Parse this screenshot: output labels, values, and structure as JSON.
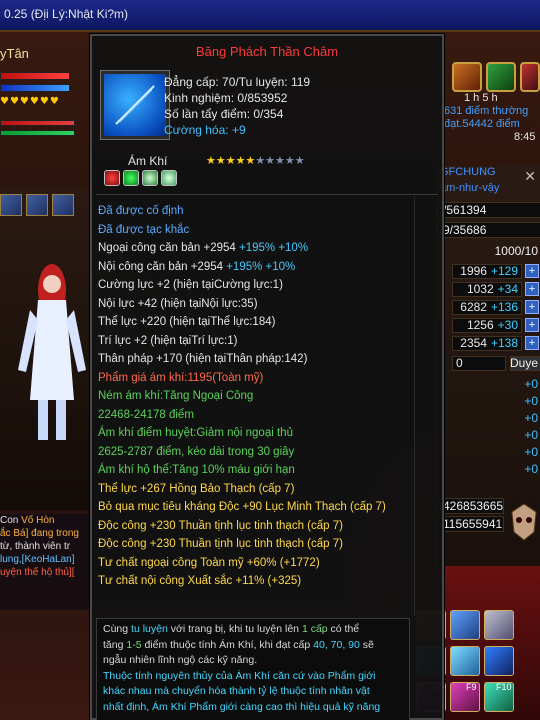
{
  "window": {
    "title": "0.25 (Địi Lý:Nhật Ki?m)"
  },
  "character": {
    "name": "yTân"
  },
  "tooltip": {
    "title": "Băng Phách Thần Châm",
    "level_line": "Đẳng cấp: 70/Tu luyện: 119",
    "exp_line": "Kinh nghiệm: 0/853952",
    "wash_line": "Số lần tẩy điểm: 0/354",
    "enhance_line": "Cường hóa: +9",
    "item_type": "Ám Khí",
    "stars_on": "★★★★★",
    "stars_off": "★★★★★",
    "lines": {
      "fixed": "Đã được cố định",
      "engraved": "Đã được tạc khắc",
      "ext_base": "Ngoại công căn bản +2954",
      "ext_base_bonus": "+195% +10%",
      "int_base": "Nội công căn bản +2954",
      "int_base_bonus": "+195% +10%",
      "str": "Cường lực +2 (hiện tạiCường lực:1)",
      "inner": "Nội lực +42 (hiện tạiNội lực:35)",
      "phys": "Thể lực +220 (hiện tạiThể lực:184)",
      "wis": "Trí lực +2 (hiện tạiTrí lực:1)",
      "agi": "Thân pháp +170 (hiện tạiThân pháp:142)",
      "grade": "Phẩm giá ám khí:1195(Toàn mỹ)",
      "throw1": "Ném ám khí:Tăng Ngoại Công",
      "throw2": "22468-24178 điểm",
      "acu1": "Ám khí điểm huyệt:Giảm nội ngoại thủ",
      "acu2": "2625-2787 điểm, kéo dài trong 30 giây",
      "guard": "Ám khí hộ thể:Tăng 10% máu giới hạn",
      "gem1": "Thể lực +267 Hồng Bảo Thạch (cấp 7)",
      "gem2": "Bỏ qua mục tiêu kháng Độc +90 Lục Minh Thạch (cấp 7)",
      "gem3": "Độc công +230 Thuần tịnh lục tinh thạch (cấp 7)",
      "gem4": "Độc công +230 Thuần tịnh lục tinh thạch (cấp 7)",
      "apt1": "Tư chất ngoại công  Toàn mỹ +60% (+1772)",
      "apt2": "Tư chất nội công  Xuất sắc +11% (+325)"
    },
    "footer": {
      "p1_a": "Cùng ",
      "p1_b": "tu luyện",
      "p1_c": " với trang bị, khi tu luyện lên ",
      "p1_d": "1 cấp",
      "p1_e": " có thể",
      "p2_a": "tăng ",
      "p2_b": "1-5",
      "p2_c": " điểm thuộc tính Ám Khí, khi đạt cấp ",
      "p2_d": "40, 70, 90",
      "p2_e": " sẽ",
      "p3": "ngẫu nhiên lĩnh ngộ các kỹ năng.",
      "p4": "Thuộc tính nguyên thủy của Ám Khí căn cứ vào Phẩm giới",
      "p5": "khác nhau mà chuyển hóa thành tỷ lệ thuộc tính nhân vật",
      "p6": "nhất định, Ám Khí Phẩm giới càng cao thì hiệu quả kỹ năng"
    }
  },
  "right_panel": {
    "timer": "1 h",
    "timer2": "5 h",
    "points_line": "631 điểm thường",
    "reached_line": "đạt.54442 điểm",
    "clock": "8:45",
    "guild": "GFCHUNG",
    "guild_sub": "ám-như-vậy",
    "exp1": "/561394",
    "exp2": "9/35686",
    "level_cap": "1000/10",
    "stats": [
      {
        "value": "1996",
        "bonus": "+129"
      },
      {
        "value": "1032",
        "bonus": "+34"
      },
      {
        "value": "6282",
        "bonus": "+136"
      },
      {
        "value": "1256",
        "bonus": "+30"
      },
      {
        "value": "2354",
        "bonus": "+138"
      }
    ],
    "remaining": "0",
    "dropdown": "Duye",
    "zeros": [
      "+0",
      "+0",
      "+0",
      "+0",
      "+0",
      "+0"
    ],
    "money1": "426853665",
    "money2": "115655941",
    "skill_keys": [
      "F8",
      "F9",
      "F10"
    ]
  },
  "chat": {
    "l1_a": "Con",
    "l1_b": "Vố Hòn",
    "l2": "ắc Bá] đang trong",
    "l3": "từ, thành viên tr",
    "l4": "lung,[KeoHaLan]",
    "l5": "uyện thế hộ thủ]["
  },
  "colors": {
    "title_red": "#ff3a3a",
    "bonus_cyan": "#48c8ff",
    "gem_yellow": "#ffd84a",
    "green": "#5ad25a"
  }
}
